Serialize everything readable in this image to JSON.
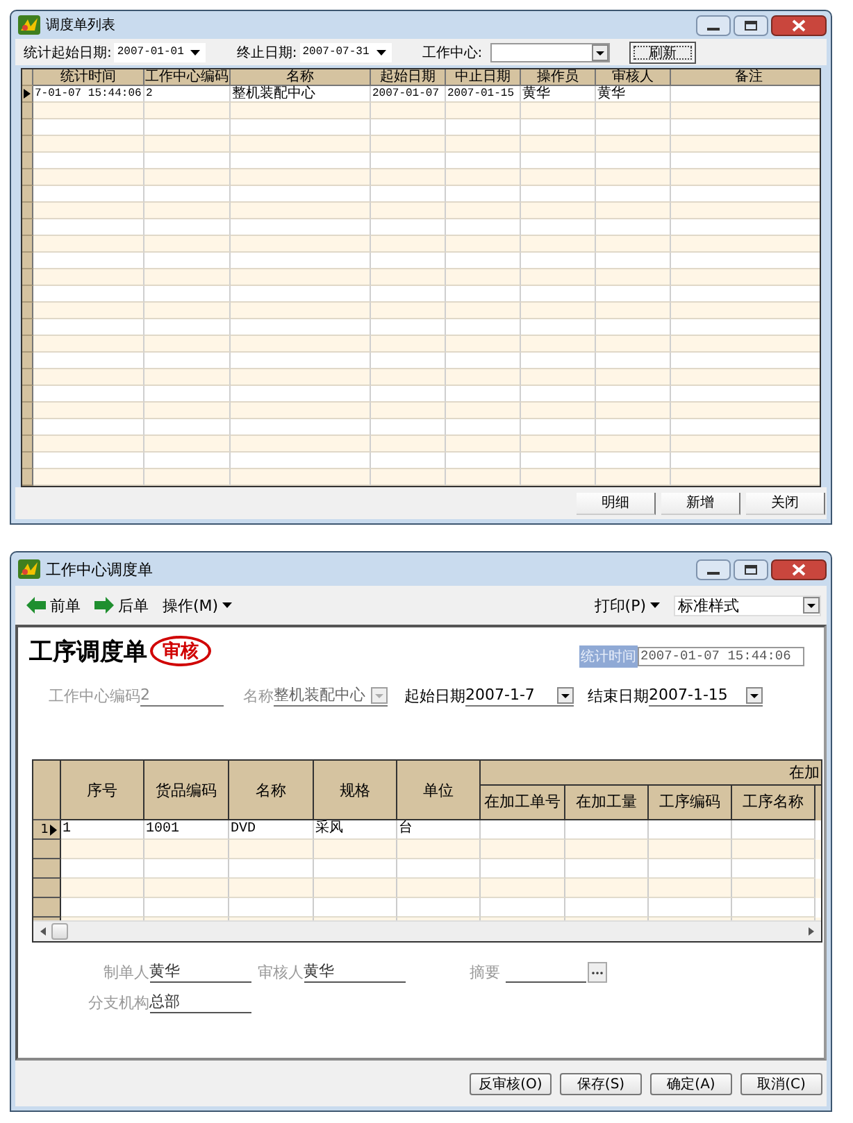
{
  "list_window": {
    "title": "调度单列表",
    "filters": [
      {
        "label": "统计起始日期:",
        "value": "2007-01-01",
        "kind": "date"
      },
      {
        "label": "终止日期:",
        "value": "2007-07-31",
        "kind": "date"
      },
      {
        "label": "工作中心:",
        "kind": "combo"
      }
    ],
    "refresh_button": "刷新",
    "table": {
      "columns": [
        "统计时间",
        "工作中心编码",
        "名称",
        "起始日期",
        "中止日期",
        "操作员",
        "审核人",
        "备注"
      ],
      "rows": [
        {
          "selected": true,
          "cells": [
            "7-01-07 15:44:06",
            "2",
            "整机装配中心",
            "2007-01-07",
            "2007-01-15",
            "黄华",
            "黄华",
            ""
          ]
        }
      ]
    },
    "buttons": [
      "明细",
      "新增",
      "关闭"
    ]
  },
  "form_window": {
    "title": "工作中心调度单",
    "toolbar": {
      "prev": "前单",
      "next": "后单",
      "operate": "操作(M)",
      "print": "打印(P)",
      "print_style": "标准样式"
    },
    "doc_title": "工序调度单",
    "stamp": "审核",
    "stat_time": {
      "label": "统计时间",
      "value": "2007-01-07 15:44:06"
    },
    "fields": [
      {
        "label": "工作中心编码",
        "value": "2",
        "kind": "text",
        "disabled": true
      },
      {
        "label": "名称",
        "value": "整机装配中心",
        "kind": "combo",
        "disabled": true
      },
      {
        "label": "起始日期",
        "value": "2007-1-7",
        "kind": "combo",
        "disabled": false
      },
      {
        "label": "结束日期",
        "value": "2007-1-15",
        "kind": "combo",
        "disabled": false
      }
    ],
    "table": {
      "columns": [
        "序号",
        "货品编码",
        "名称",
        "规格",
        "单位"
      ],
      "group": {
        "label": "在加",
        "columns": [
          "在加工单号",
          "在加工量",
          "工序编码",
          "工序名称"
        ]
      },
      "rows": [
        {
          "row_number": "1",
          "selected": true,
          "cells": [
            "1",
            "1001",
            "DVD",
            "采风",
            "台",
            "",
            "",
            "",
            ""
          ]
        }
      ]
    },
    "footer_fields": [
      {
        "label": "制单人",
        "value": "黄华",
        "kind": "text"
      },
      {
        "label": "审核人",
        "value": "黄华",
        "kind": "text"
      },
      {
        "label": "摘要",
        "kind": "lookup"
      },
      {
        "label": "分支机构",
        "value": "总部",
        "kind": "text"
      }
    ],
    "buttons": [
      "反审核(O)",
      "保存(S)",
      "确定(A)",
      "取消(C)"
    ]
  }
}
